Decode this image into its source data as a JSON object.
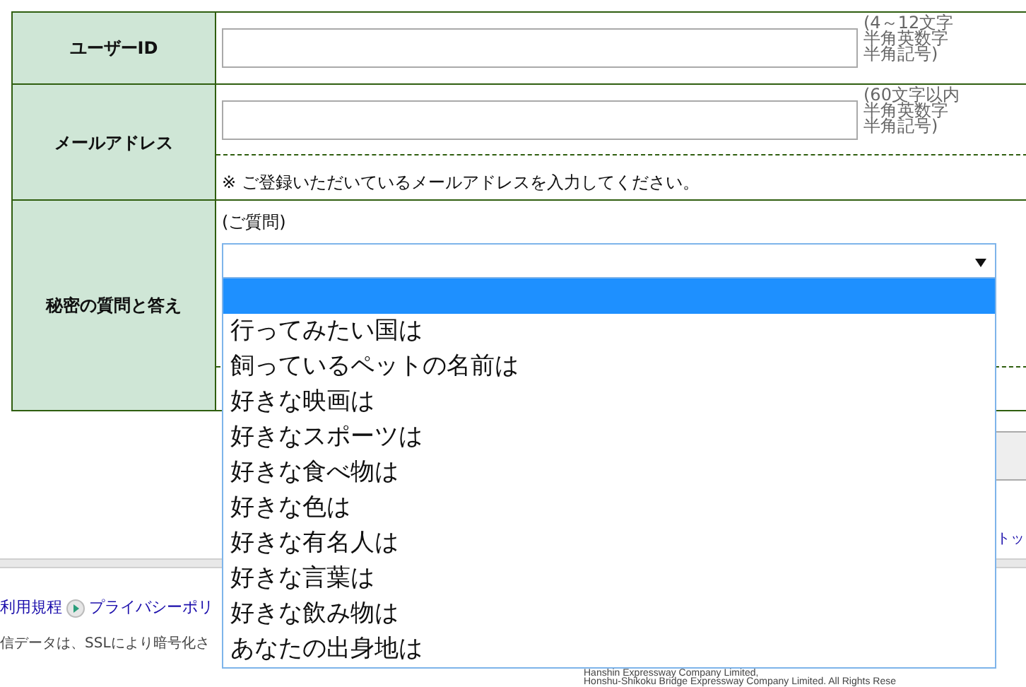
{
  "form_rows": [
    {
      "label": "ユーザーID",
      "kind": "input",
      "note_lines": [
        "(4～12文字",
        "半角英数字",
        "半角記号)"
      ]
    },
    {
      "label": "メールアドレス",
      "kind": "input",
      "note_lines": [
        "(60文字以内",
        "半角英数字",
        "半角記号)"
      ],
      "hint": "※ ご登録いただいているメールアドレスを入力してください。"
    },
    {
      "label": "秘密の質問と答え",
      "kind": "select",
      "caption": "(ご質問)",
      "dropdown": {
        "expanded": true,
        "options": [
          {
            "selected": true
          },
          {
            "label": "行ってみたい国は",
            "selected": false
          },
          {
            "label": "飼っているペットの名前は",
            "selected": false
          },
          {
            "label": "好きな映画は",
            "selected": false
          },
          {
            "label": "好きなスポーツは",
            "selected": false
          },
          {
            "label": "好きな食べ物は",
            "selected": false
          },
          {
            "label": "好きな色は",
            "selected": false
          },
          {
            "label": "好きな有名人は",
            "selected": false
          },
          {
            "label": "好きな言葉は",
            "selected": false
          },
          {
            "label": "好きな飲み物は",
            "selected": false
          },
          {
            "label": "あなたの出身地は",
            "selected": false
          }
        ]
      }
    }
  ],
  "side_link": "トッ",
  "footer_links": [
    {
      "label": "利用規程"
    },
    {
      "label": "プライバシーポリ"
    }
  ],
  "ssl_note": "信データは、SSLにより暗号化さ",
  "copyright_lines": [
    "Hanshin Expressway Company Limited,",
    "Honshu-Shikoku Bridge Expressway Company Limited. All Rights Rese"
  ]
}
